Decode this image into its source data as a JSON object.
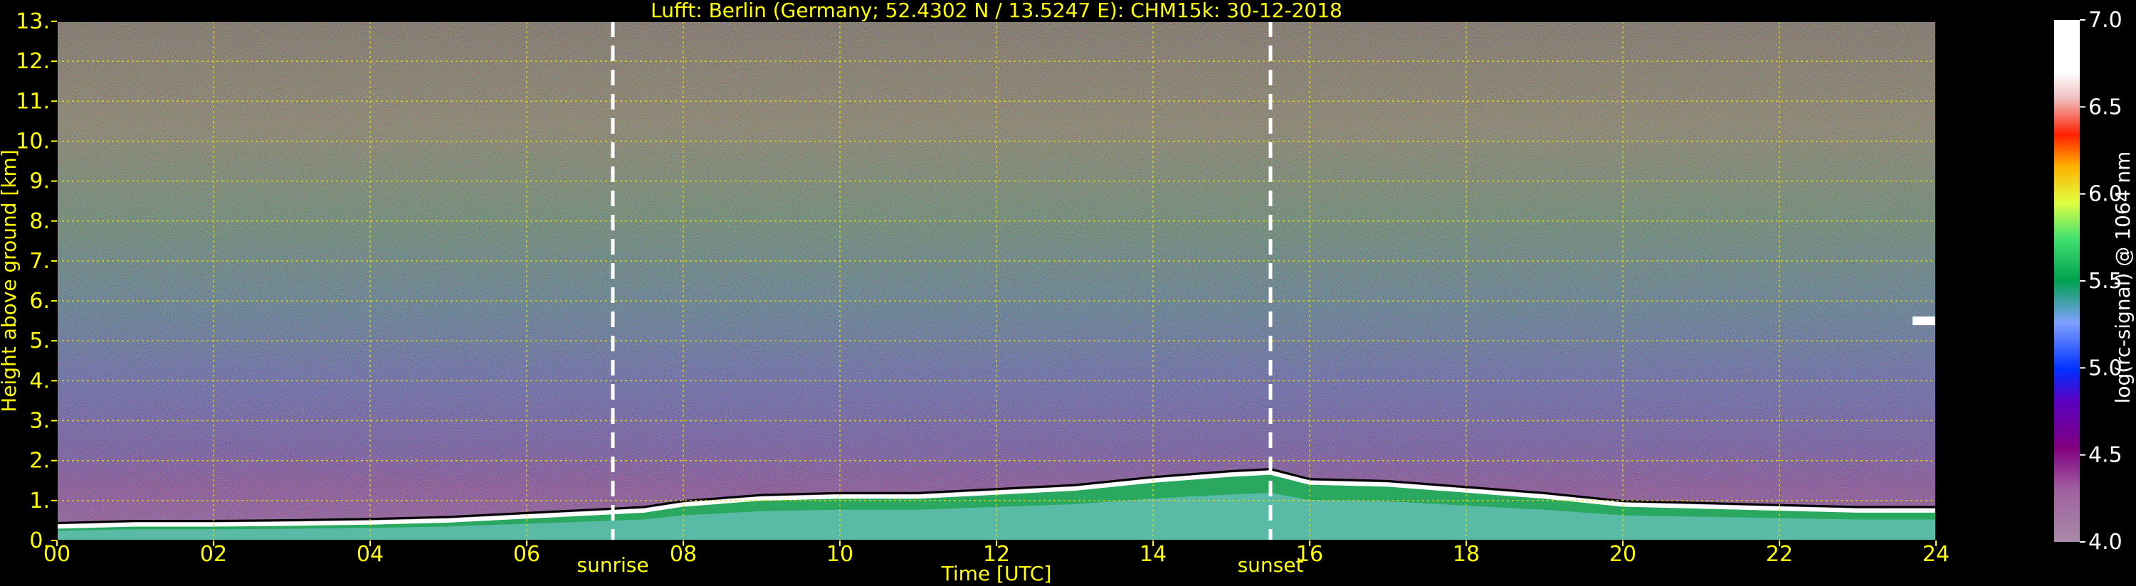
{
  "chart_data": {
    "type": "heatmap",
    "title": "Lufft: Berlin (Germany; 52.4302 N / 13.5247 E):    CHM15k: 30-12-2018",
    "xlabel": "Time [UTC]",
    "ylabel": "Height above ground [km]",
    "xlim": [
      0,
      24
    ],
    "ylim": [
      0,
      13
    ],
    "x_ticks": [
      "00",
      "02",
      "04",
      "06",
      "08",
      "10",
      "12",
      "14",
      "16",
      "18",
      "20",
      "22",
      "24"
    ],
    "y_ticks": [
      "0.",
      "1.",
      "2.",
      "3.",
      "4.",
      "5.",
      "6.",
      "7.",
      "8.",
      "9.",
      "10.",
      "11.",
      "12.",
      "13."
    ],
    "grid": true,
    "annotations": [
      {
        "label": "sunrise",
        "x": 7.1
      },
      {
        "label": "sunset",
        "x": 15.5
      }
    ],
    "colorbar": {
      "label": "log(rc-signal) @ 1064 nm",
      "range": [
        4.0,
        7.0
      ],
      "ticks": [
        "4.0",
        "4.5",
        "5.0",
        "5.5",
        "6.0",
        "6.5",
        "7.0"
      ]
    },
    "boundary_layer_top_km": {
      "x": [
        0,
        1,
        2,
        3,
        4,
        5,
        6,
        7,
        7.5,
        8,
        9,
        10,
        11,
        12,
        13,
        14,
        15,
        15.5,
        16,
        17,
        18,
        19,
        20,
        21,
        22,
        23,
        24
      ],
      "values": [
        0.35,
        0.4,
        0.4,
        0.42,
        0.45,
        0.5,
        0.6,
        0.7,
        0.75,
        0.9,
        1.05,
        1.1,
        1.1,
        1.2,
        1.3,
        1.5,
        1.65,
        1.7,
        1.45,
        1.4,
        1.25,
        1.1,
        0.9,
        0.85,
        0.8,
        0.75,
        0.75
      ]
    },
    "cloud_layer": {
      "x_start": 23.7,
      "x_end": 24,
      "height_km": 5.5
    }
  }
}
